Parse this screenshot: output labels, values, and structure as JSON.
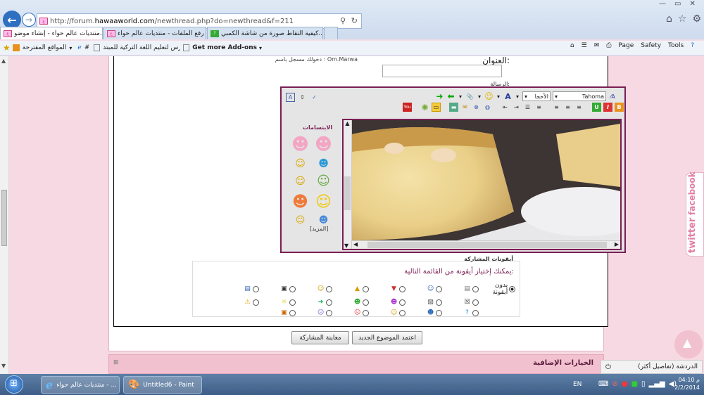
{
  "browser": {
    "url_prefix": "http://forum.",
    "url_domain": "hawaaworld.com",
    "url_rest": "/newthread.php?do=newthread&f=211",
    "tabs": [
      {
        "label": "منتديات عالم حواء - إنشاء موضو..."
      },
      {
        "label": "نظام رفع الملفات - منتديات عالم حواء"
      },
      {
        "label": "كيفية التقاط صورة من شاشة الكمبي..."
      }
    ],
    "favorites": [
      {
        "label": "المواقع المقترحة"
      },
      {
        "label": "#"
      },
      {
        "label": "كورس لتعليم اللغة التركية للمبتد..."
      },
      {
        "label": "Get more Add-ons"
      }
    ],
    "commands": [
      {
        "label": "Page"
      },
      {
        "label": "Safety"
      },
      {
        "label": "Tools"
      }
    ]
  },
  "form": {
    "logged_in_as": "دخولك مسجل باسم : Om.Marwa",
    "title_label": "العنوان:",
    "title_value": "",
    "message_label": "الرسالة:",
    "font_select": "Tahoma",
    "size_select": "الأحجا",
    "smilies_heading": "الابتسامات",
    "more_smilies": "[المزيد]",
    "icons_legend": "أيقونات المشاركة",
    "icons_prompt": "يمكنك إختيار أيقونة من القائمة التالية:",
    "no_icon_label": "بدون أيقونة",
    "submit_button": "اعتمد الموضوع الجديد",
    "preview_button": "معاينة المشاركة",
    "extra_options": "الخيارات الإضافية"
  },
  "chat": {
    "label": "الدردشة (تفاصيل أكثر)"
  },
  "side_buttons": [
    {
      "label": "twitter"
    },
    {
      "label": "facebook"
    }
  ],
  "taskbar": {
    "items": [
      {
        "label": "منتديات عالم حواء - ..."
      },
      {
        "label": "Untitled6 - Paint"
      }
    ],
    "lang": "EN",
    "time": "04:10 م",
    "date": "2/2/2014"
  }
}
